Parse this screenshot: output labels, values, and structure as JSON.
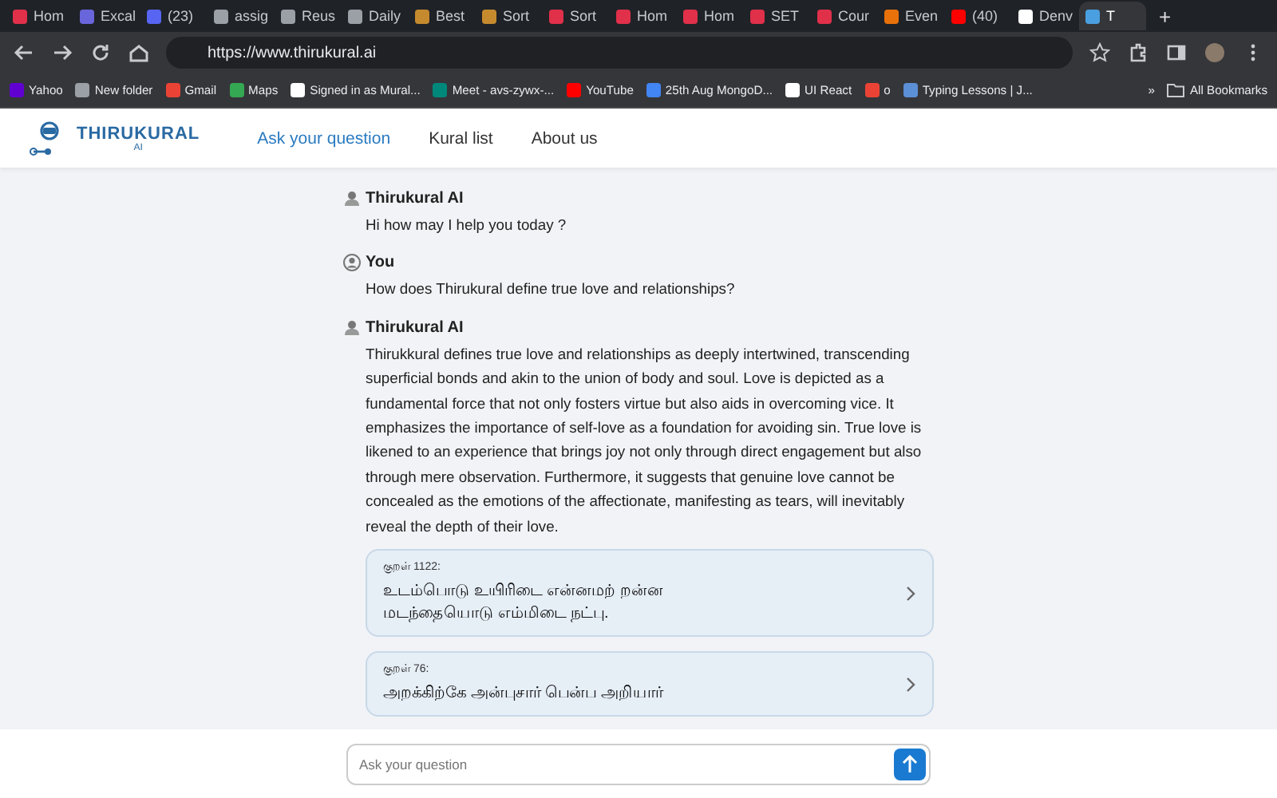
{
  "browser": {
    "tabs": [
      {
        "title": "Hom",
        "color": "#e0304a",
        "selected": false
      },
      {
        "title": "Excal",
        "color": "#6965db",
        "selected": false
      },
      {
        "title": "(23)",
        "color": "#5865f2",
        "selected": false
      },
      {
        "title": "assig",
        "color": "#9aa0a6",
        "selected": false
      },
      {
        "title": "Reus",
        "color": "#9aa0a6",
        "selected": false
      },
      {
        "title": "Daily",
        "color": "#9aa0a6",
        "selected": false
      },
      {
        "title": "Best",
        "color": "#c58a2e",
        "selected": false
      },
      {
        "title": "Sort",
        "color": "#c58a2e",
        "selected": false
      },
      {
        "title": "Sort",
        "color": "#e0304a",
        "selected": false
      },
      {
        "title": "Hom",
        "color": "#e0304a",
        "selected": false
      },
      {
        "title": "Hom",
        "color": "#e0304a",
        "selected": false
      },
      {
        "title": "SET",
        "color": "#e0304a",
        "selected": false
      },
      {
        "title": "Cour",
        "color": "#e0304a",
        "selected": false
      },
      {
        "title": "Even",
        "color": "#e8710a",
        "selected": false
      },
      {
        "title": "(40)",
        "color": "#ff0000",
        "selected": false
      },
      {
        "title": "Denv",
        "color": "#ffffff",
        "selected": false
      },
      {
        "title": "T",
        "color": "#4a9fe0",
        "selected": true
      }
    ],
    "new_tab": "+",
    "url": "https://www.thirukural.ai",
    "bookmarks": [
      {
        "label": "Yahoo",
        "color": "#6001d2"
      },
      {
        "label": "New folder",
        "color": "#9aa0a6"
      },
      {
        "label": "Gmail",
        "color": "#ea4335"
      },
      {
        "label": "Maps",
        "color": "#34a853"
      },
      {
        "label": "Signed in as Mural...",
        "color": "#ffffff"
      },
      {
        "label": "Meet - avs-zywx-...",
        "color": "#00897b"
      },
      {
        "label": "YouTube",
        "color": "#ff0000"
      },
      {
        "label": "25th Aug MongoD...",
        "color": "#4285f4"
      },
      {
        "label": "UI React",
        "color": "#ffffff"
      },
      {
        "label": "o",
        "color": "#ea4335"
      },
      {
        "label": "Typing Lessons | J...",
        "color": "#5b8fd6"
      }
    ],
    "more": "»",
    "all_bookmarks": "All Bookmarks"
  },
  "site": {
    "logo": {
      "name": "THIRUKURAL",
      "sub": "AI"
    },
    "nav": [
      {
        "label": "Ask your question",
        "selected": true
      },
      {
        "label": "Kural list",
        "selected": false
      },
      {
        "label": "About us",
        "selected": false
      }
    ]
  },
  "messages": [
    {
      "kind": "bot",
      "author": "Thirukural AI",
      "text": "Hi how may I help you today ?"
    },
    {
      "kind": "user",
      "author": "You",
      "text": "How does Thirukural define true love and relationships?"
    },
    {
      "kind": "bot",
      "author": "Thirukural AI",
      "text": "Thirukkural defines true love and relationships as deeply intertwined, transcending superficial bonds and akin to the union of body and soul. Love is depicted as a fundamental force that not only fosters virtue but also aids in overcoming vice. It emphasizes the importance of self-love as a foundation for avoiding sin. True love is likened to an experience that brings joy not only through direct engagement but also through mere observation. Furthermore, it suggests that genuine love cannot be concealed as the emotions of the affectionate, manifesting as tears, will inevitably reveal the depth of their love.",
      "kurals": [
        {
          "label": "குறள் 1122:",
          "lines": [
            "உடம்பொடு உயிரிடை என்னமற் றன்ன",
            "மடந்தையொடு எம்மிடை நட்பு."
          ]
        },
        {
          "label": "குறள் 76:",
          "lines": [
            "அறக்கிற்கே அன்புசார் பென்ப அறியார்"
          ]
        }
      ]
    }
  ],
  "composer": {
    "placeholder": "Ask your question"
  }
}
